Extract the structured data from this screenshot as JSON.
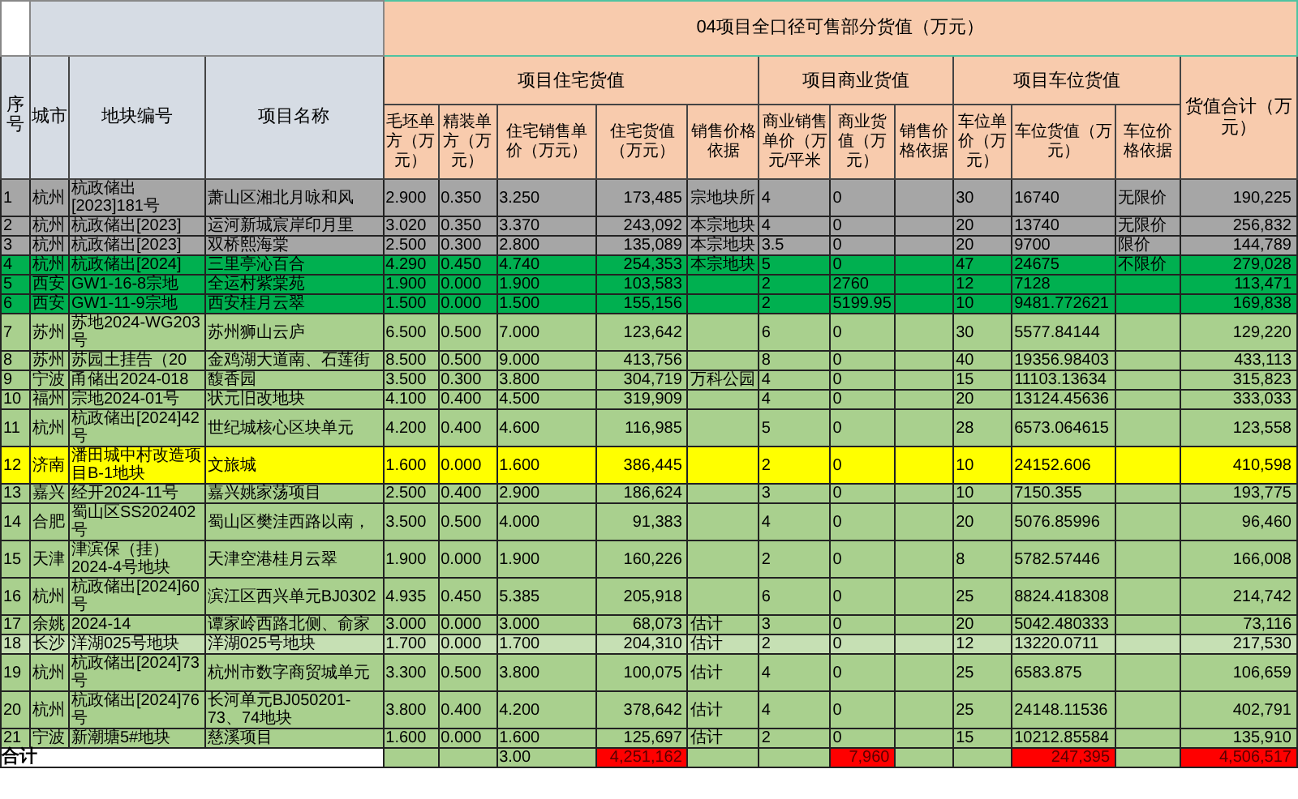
{
  "title": "04项目全口径可售部分货值（万元）",
  "left_columns": [
    "序号",
    "城市",
    "地块编号",
    "项目名称"
  ],
  "groups": [
    {
      "label": "项目住宅货值",
      "columns": [
        "毛坯单方（万元）",
        "精装单方（万元）",
        "住宅销售单价（万元）",
        "住宅货值（万元）",
        "销售价格依据"
      ]
    },
    {
      "label": "项目商业货值",
      "columns": [
        "商业销售单价（万元/平米",
        "商业货值（万元）",
        "销售价格依据"
      ]
    },
    {
      "label": "项目车位货值",
      "columns": [
        "车位单价（万元）",
        "车位货值（万元）",
        "车位价格依据"
      ]
    }
  ],
  "total_column": "货值合计（万元）",
  "rows": [
    {
      "color": "#a6a6a6",
      "cells": [
        "1",
        "杭州",
        "杭政储出[2023]181号",
        "萧山区湘北月咏和风",
        "2.900",
        "0.350",
        "3.250",
        "173,485",
        "宗地块所",
        "4",
        "0",
        null,
        "30",
        "16740",
        "无限价",
        "190,225"
      ]
    },
    {
      "color": "#a6a6a6",
      "cells": [
        "2",
        "杭州",
        "杭政储出[2023]",
        "运河新城宸岸印月里",
        "3.020",
        "0.350",
        "3.370",
        "243,092",
        "本宗地块",
        "4",
        "0",
        null,
        "20",
        "13740",
        "无限价",
        "256,832"
      ]
    },
    {
      "color": "#a6a6a6",
      "cells": [
        "3",
        "杭州",
        "杭政储出[2023]",
        "双桥熙海棠",
        "2.500",
        "0.300",
        "2.800",
        "135,089",
        "本宗地块",
        "3.5",
        "0",
        null,
        "20",
        "9700",
        "限价",
        "144,789"
      ]
    },
    {
      "color": "#00b050",
      "cells": [
        "4",
        "杭州",
        "杭政储出[2024]",
        "三里亭沁百合",
        "4.290",
        "0.450",
        "4.740",
        "254,353",
        "本宗地块",
        "5",
        "0",
        null,
        "47",
        "24675",
        "不限价",
        "279,028"
      ]
    },
    {
      "color": "#00b050",
      "cells": [
        "5",
        "西安",
        "GW1-16-8宗地",
        "全运村紫棠苑",
        "1.900",
        "0.000",
        "1.900",
        "103,583",
        null,
        "2",
        "2760",
        null,
        "12",
        "7128",
        null,
        "113,471"
      ]
    },
    {
      "color": "#00b050",
      "cells": [
        "6",
        "西安",
        "GW1-11-9宗地",
        "西安桂月云翠",
        "1.500",
        "0.000",
        "1.500",
        "155,156",
        null,
        "2",
        "5199.95",
        null,
        "10",
        "9481.772621",
        null,
        "169,838"
      ]
    },
    {
      "color": "#a9d08e",
      "cells": [
        "7",
        "苏州",
        "苏地2024-WG203号",
        "苏州狮山云庐",
        "6.500",
        "0.500",
        "7.000",
        "123,642",
        null,
        "6",
        "0",
        null,
        "30",
        "5577.84144",
        null,
        "129,220"
      ]
    },
    {
      "color": "#a9d08e",
      "cells": [
        "8",
        "苏州",
        "苏园土挂告（20",
        "金鸡湖大道南、石莲街",
        "8.500",
        "0.500",
        "9.000",
        "413,756",
        null,
        "8",
        "0",
        null,
        "40",
        "19356.98403",
        null,
        "433,113"
      ]
    },
    {
      "color": "#a9d08e",
      "cells": [
        "9",
        "宁波",
        "甬储出2024-018",
        "馥香园",
        "3.500",
        "0.300",
        "3.800",
        "304,719",
        "万科公园",
        "4",
        "0",
        null,
        "15",
        "11103.13634",
        null,
        "315,823"
      ]
    },
    {
      "color": "#a9d08e",
      "cells": [
        "10",
        "福州",
        "宗地2024-01号",
        "状元旧改地块",
        "4.100",
        "0.400",
        "4.500",
        "319,909",
        null,
        "4",
        "0",
        null,
        "20",
        "13124.45636",
        null,
        "333,033"
      ]
    },
    {
      "color": "#a9d08e",
      "cells": [
        "11",
        "杭州",
        "杭政储出[2024]42号",
        "世纪城核心区块单元",
        "4.200",
        "0.400",
        "4.600",
        "116,985",
        null,
        "5",
        "0",
        null,
        "28",
        "6573.064615",
        null,
        "123,558"
      ]
    },
    {
      "color": "#ffff00",
      "cells": [
        "12",
        "济南",
        "潘田城中村改造项目B-1地块",
        "文旅城",
        "1.600",
        "0.000",
        "1.600",
        "386,445",
        null,
        "2",
        "0",
        null,
        "10",
        "24152.606",
        null,
        "410,598"
      ]
    },
    {
      "color": "#a9d08e",
      "cells": [
        "13",
        "嘉兴",
        "经开2024-11号",
        "嘉兴姚家荡项目",
        "2.500",
        "0.400",
        "2.900",
        "186,624",
        null,
        "3",
        "0",
        null,
        "10",
        "7150.355",
        null,
        "193,775"
      ]
    },
    {
      "color": "#a9d08e",
      "cells": [
        "14",
        "合肥",
        "蜀山区SS202402号",
        "蜀山区樊洼西路以南，",
        "3.500",
        "0.500",
        "4.000",
        "91,383",
        null,
        "4",
        "0",
        null,
        "20",
        "5076.85996",
        null,
        "96,460"
      ]
    },
    {
      "color": "#a9d08e",
      "cells": [
        "15",
        "天津",
        "津滨保（挂）2024-4号地块",
        "天津空港桂月云翠",
        "1.900",
        "0.000",
        "1.900",
        "160,226",
        null,
        "2",
        "0",
        null,
        "8",
        "5782.57446",
        null,
        "166,008"
      ]
    },
    {
      "color": "#a9d08e",
      "cells": [
        "16",
        "杭州",
        "杭政储出[2024]60号",
        "滨江区西兴单元BJ0302",
        "4.935",
        "0.450",
        "5.385",
        "205,918",
        null,
        "6",
        "0",
        null,
        "25",
        "8824.418308",
        null,
        "214,742"
      ]
    },
    {
      "color": "#a9d08e",
      "cells": [
        "17",
        "余姚",
        "2024-14",
        "谭家岭西路北侧、俞家",
        "3.000",
        "0.000",
        "3.000",
        "68,073",
        "估计",
        "3",
        "0",
        null,
        "20",
        "5042.480333",
        null,
        "73,116"
      ]
    },
    {
      "color": "#c6e0b4",
      "cells": [
        "18",
        "长沙",
        "洋湖025号地块",
        "洋湖025号地块",
        "1.700",
        "0.000",
        "1.700",
        "204,310",
        "估计",
        "2",
        "0",
        null,
        "12",
        "13220.0711",
        null,
        "217,530"
      ]
    },
    {
      "color": "#a9d08e",
      "cells": [
        "19",
        "杭州",
        "杭政储出[2024]73号",
        "杭州市数字商贸城单元",
        "3.300",
        "0.500",
        "3.800",
        "100,075",
        "估计",
        "4",
        "0",
        null,
        "25",
        "6583.875",
        null,
        "106,659"
      ]
    },
    {
      "color": "#a9d08e",
      "cells": [
        "20",
        "杭州",
        "杭政储出[2024]76号",
        "长河单元BJ050201-73、74地块",
        "3.800",
        "0.400",
        "4.200",
        "378,642",
        "估计",
        "4",
        "0",
        null,
        "25",
        "24148.11536",
        null,
        "402,791"
      ]
    },
    {
      "color": "#a9d08e",
      "cells": [
        "21",
        "宁波",
        "新潮塘5#地块",
        "慈溪项目",
        "1.600",
        "0.000",
        "1.600",
        "125,697",
        "估计",
        "2",
        "0",
        null,
        "15",
        "10212.85584",
        null,
        "135,910"
      ]
    }
  ],
  "total": {
    "label": "合计",
    "unit_price": "3.00",
    "residential_value": "4,251,162",
    "commercial_value": "7,960",
    "parking_value": "247,395",
    "grand_total": "4,506,517"
  }
}
